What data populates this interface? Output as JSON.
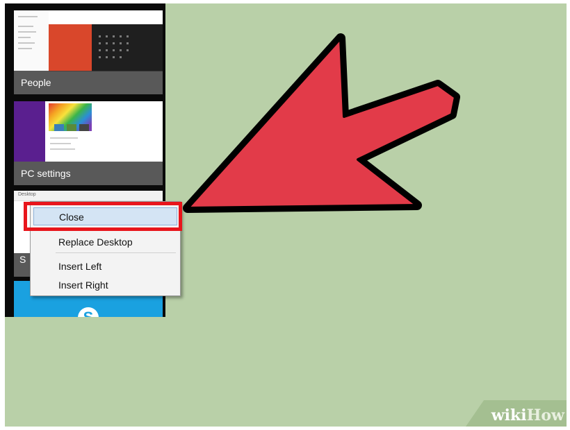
{
  "tiles": [
    {
      "label": "People"
    },
    {
      "label": "PC settings"
    },
    {
      "label": "S",
      "header_text": "Desktop"
    },
    {
      "label": "",
      "icon": "skype-icon",
      "icon_glyph": "S"
    }
  ],
  "context_menu": {
    "items": [
      {
        "label": "Close"
      },
      {
        "label": "Replace Desktop"
      },
      {
        "label": "Insert Left"
      },
      {
        "label": "Insert Right"
      }
    ]
  },
  "colors": {
    "background": "#b9d0a8",
    "arrow_fill": "#e23b49",
    "highlight": "#e8151b",
    "skype": "#1aa1e0"
  },
  "watermark": {
    "part1": "wiki",
    "part2": "How"
  }
}
